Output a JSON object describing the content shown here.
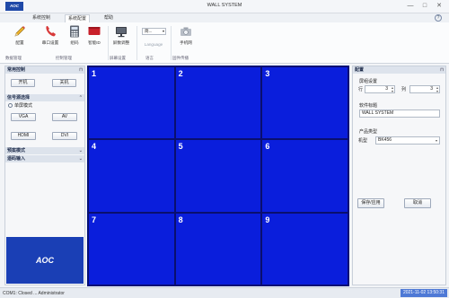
{
  "app": {
    "logo_text": "AOC",
    "title": "WALL SYSTEM",
    "window_controls": {
      "minimize": "—",
      "maximize": "□",
      "close": "✕"
    }
  },
  "tabs": [
    {
      "label": "系统控制",
      "active": false
    },
    {
      "label": "系统配置",
      "active": true
    },
    {
      "label": "帮助",
      "active": false
    }
  ],
  "help_icon": "?",
  "ribbon": {
    "buttons": [
      {
        "label": "配置",
        "icon": "pencil-icon"
      },
      {
        "label": "串口设置",
        "icon": "phone-icon"
      },
      {
        "label": "组码",
        "icon": "calculator-icon"
      },
      {
        "label": "智能ID",
        "icon": "red-id-card-icon"
      },
      {
        "label": "屏数调整",
        "icon": "monitor-icon"
      },
      {
        "label": "Language",
        "icon": "globe-icon"
      },
      {
        "label": "手机网",
        "icon": "camera-icon"
      }
    ],
    "language_value": "简...",
    "groups": [
      "数据管理",
      "控制管理",
      "屏幕设置",
      "语言",
      "固件传播"
    ]
  },
  "left_panel": {
    "sections": {
      "power": {
        "title": "常用控制",
        "on_label": "开机",
        "off_label": "关机"
      },
      "signal": {
        "title": "信号源选择",
        "single_mode_label": "单屏模式",
        "sources": [
          "VGA",
          "AV",
          "HDMI",
          "DVI"
        ]
      },
      "preset": {
        "title": "预案模式"
      },
      "remote": {
        "title": "遥码输入"
      }
    },
    "logo_text": "AOC"
  },
  "grid": {
    "rows": 3,
    "cols": 3,
    "cells": [
      "1",
      "2",
      "3",
      "4",
      "5",
      "6",
      "7",
      "8",
      "9"
    ],
    "color": "#0a1edc"
  },
  "right_panel": {
    "title": "配置",
    "layout_label": "屏组设置",
    "row_label": "行",
    "row_value": "3",
    "col_label": "列",
    "col_value": "3",
    "software_title_label": "软件标题",
    "software_title_value": "WALL SYSTEM",
    "product_type_label": "产品类型",
    "model_label": "机型",
    "model_value": "BK456",
    "save_label": "保存/应用",
    "cancel_label": "取消"
  },
  "statusbar": {
    "left": "COM1: Closed ... Administrator",
    "time": "2021-11-02 13:50:31"
  },
  "colors": {
    "accent": "#1f49a8",
    "grid_blue": "#0a1edc",
    "status_time_bg": "#4e79d6"
  }
}
